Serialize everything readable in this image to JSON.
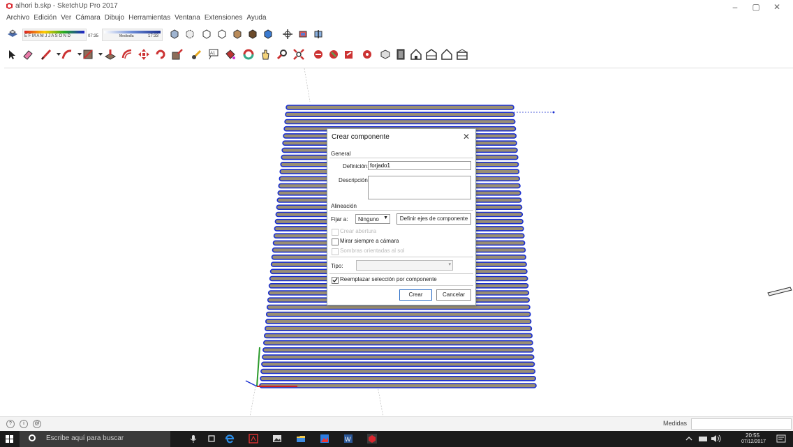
{
  "window": {
    "title": "alhori b.skp - SketchUp Pro 2017"
  },
  "menu": [
    "Archivo",
    "Edición",
    "Ver",
    "Cámara",
    "Dibujo",
    "Herramientas",
    "Ventana",
    "Extensiones",
    "Ayuda"
  ],
  "shadows": {
    "months": "E F M A M J J A S O N D",
    "time_start": "07:35",
    "midday": "Mediodía",
    "time_end": "17:33"
  },
  "dialog": {
    "title": "Crear componente",
    "section_general": "General",
    "definition_label": "Definición:",
    "definition_value": "forjado1",
    "description_label": "Descripción:",
    "description_value": "",
    "section_alignment": "Alineación",
    "glue_label": "Fijar a:",
    "glue_value": "Ninguno",
    "set_axes_button": "Definir ejes de componente",
    "cut_opening": "Crear abertura",
    "face_camera": "Mirar siempre a cámara",
    "shadows_sun": "Sombras orientadas al sol",
    "type_label": "Tipo:",
    "type_value": "",
    "replace_selection": "Reemplazar selección por componente",
    "create_button": "Crear",
    "cancel_button": "Cancelar"
  },
  "status": {
    "measures_label": "Medidas",
    "measures_value": ""
  },
  "taskbar": {
    "search_placeholder": "Escribe aquí para buscar",
    "time": "20:55",
    "date": "07/12/2017"
  },
  "colors": {
    "accent_blue": "#1a2fd0",
    "slab_fill": "#9a8f72",
    "taskbar": "#1b1b1b",
    "default_button": "#2e6fc7"
  }
}
